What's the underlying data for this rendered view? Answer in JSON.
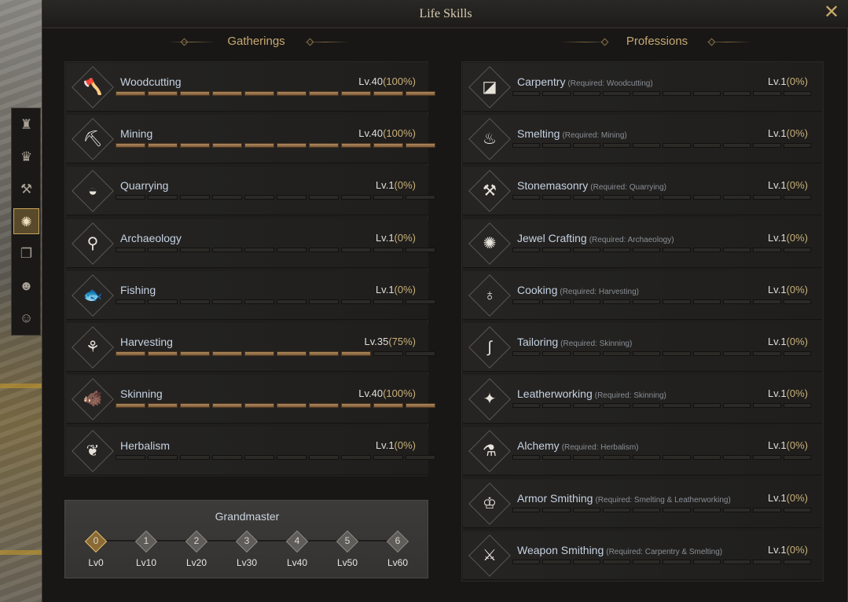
{
  "window": {
    "title": "Life Skills",
    "close_icon": "close-x-icon"
  },
  "side_tabs": [
    {
      "icon": "character-icon",
      "glyph": "♜"
    },
    {
      "icon": "crest-icon",
      "glyph": "♛"
    },
    {
      "icon": "anvil-icon",
      "glyph": "⚒"
    },
    {
      "icon": "life-skills-icon",
      "glyph": "✺",
      "active": true
    },
    {
      "icon": "book-icon",
      "glyph": "❐"
    },
    {
      "icon": "companions-icon",
      "glyph": "☻"
    },
    {
      "icon": "emote-icon",
      "glyph": "☺"
    }
  ],
  "gatherings": {
    "header": "Gatherings",
    "items": [
      {
        "name": "Woodcutting",
        "level": "Lv.40",
        "percent": "(100%)",
        "icon": "woodcutting-icon",
        "glyph": "🪓",
        "fill": 1.0
      },
      {
        "name": "Mining",
        "level": "Lv.40",
        "percent": "(100%)",
        "icon": "mining-icon",
        "glyph": "⛏",
        "fill": 1.0
      },
      {
        "name": "Quarrying",
        "level": "Lv.1",
        "percent": "(0%)",
        "icon": "quarrying-icon",
        "glyph": "◒",
        "fill": 0
      },
      {
        "name": "Archaeology",
        "level": "Lv.1",
        "percent": "(0%)",
        "icon": "archaeology-icon",
        "glyph": "⚲",
        "fill": 0
      },
      {
        "name": "Fishing",
        "level": "Lv.1",
        "percent": "(0%)",
        "icon": "fishing-icon",
        "glyph": "🐟",
        "fill": 0
      },
      {
        "name": "Harvesting",
        "level": "Lv.35",
        "percent": "(75%)",
        "icon": "harvesting-icon",
        "glyph": "⚘",
        "fill": 0.75
      },
      {
        "name": "Skinning",
        "level": "Lv.40",
        "percent": "(100%)",
        "icon": "skinning-icon",
        "glyph": "🐗",
        "fill": 1.0
      },
      {
        "name": "Herbalism",
        "level": "Lv.1",
        "percent": "(0%)",
        "icon": "herbalism-icon",
        "glyph": "❦",
        "fill": 0
      }
    ]
  },
  "professions": {
    "header": "Professions",
    "items": [
      {
        "name": "Carpentry",
        "req": "(Required: Woodcutting)",
        "level": "Lv.1",
        "percent": "(0%)",
        "icon": "carpentry-saw-icon",
        "glyph": "◪"
      },
      {
        "name": "Smelting",
        "req": "(Required: Mining)",
        "level": "Lv.1",
        "percent": "(0%)",
        "icon": "smelting-icon",
        "glyph": "♨"
      },
      {
        "name": "Stonemasonry",
        "req": "(Required: Quarrying)",
        "level": "Lv.1",
        "percent": "(0%)",
        "icon": "stonemasonry-hammer-icon",
        "glyph": "⚒"
      },
      {
        "name": "Jewel Crafting",
        "req": "(Required: Archaeology)",
        "level": "Lv.1",
        "percent": "(0%)",
        "icon": "jewel-crafting-icon",
        "glyph": "✺"
      },
      {
        "name": "Cooking",
        "req": "(Required: Harvesting)",
        "level": "Lv.1",
        "percent": "(0%)",
        "icon": "cooking-pot-icon",
        "glyph": "♁"
      },
      {
        "name": "Tailoring",
        "req": "(Required: Skinning)",
        "level": "Lv.1",
        "percent": "(0%)",
        "icon": "tailoring-needle-icon",
        "glyph": "∫"
      },
      {
        "name": "Leatherworking",
        "req": "(Required: Skinning)",
        "level": "Lv.1",
        "percent": "(0%)",
        "icon": "leatherworking-icon",
        "glyph": "✦"
      },
      {
        "name": "Alchemy",
        "req": "(Required: Herbalism)",
        "level": "Lv.1",
        "percent": "(0%)",
        "icon": "alchemy-flask-icon",
        "glyph": "⚗"
      },
      {
        "name": "Armor Smithing",
        "req": "(Required: Smelting & Leatherworking)",
        "level": "Lv.1",
        "percent": "(0%)",
        "icon": "armor-smithing-icon",
        "glyph": "♔"
      },
      {
        "name": "Weapon Smithing",
        "req": "(Required: Carpentry & Smelting)",
        "level": "Lv.1",
        "percent": "(0%)",
        "icon": "weapon-smithing-icon",
        "glyph": "⚔"
      }
    ]
  },
  "grandmaster": {
    "title": "Grandmaster",
    "tiers": [
      {
        "num": "0",
        "label": "Lv0",
        "achieved": true
      },
      {
        "num": "1",
        "label": "Lv10"
      },
      {
        "num": "2",
        "label": "Lv20"
      },
      {
        "num": "3",
        "label": "Lv30"
      },
      {
        "num": "4",
        "label": "Lv40"
      },
      {
        "num": "5",
        "label": "Lv50"
      },
      {
        "num": "6",
        "label": "Lv60"
      }
    ]
  }
}
